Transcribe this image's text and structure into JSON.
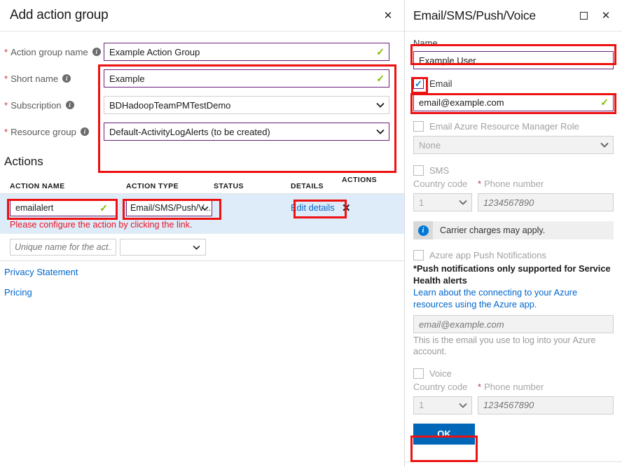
{
  "left_blade": {
    "title": "Add action group",
    "close_label": "✕",
    "fields": [
      {
        "label": "Action group name",
        "required": true,
        "value": "Example Action Group",
        "type": "text",
        "valid": true
      },
      {
        "label": "Short name",
        "required": true,
        "value": "Example",
        "type": "text",
        "valid": true
      },
      {
        "label": "Subscription",
        "required": true,
        "value": "BDHadoopTeamPMTestDemo",
        "type": "select",
        "valid": false
      },
      {
        "label": "Resource group",
        "required": true,
        "value": "Default-ActivityLogAlerts (to be created)",
        "type": "select",
        "valid": false
      }
    ],
    "actions_heading": "Actions",
    "table": {
      "headers": [
        "ACTION NAME",
        "ACTION TYPE",
        "STATUS",
        "DETAILS",
        "ACTIONS"
      ],
      "row": {
        "name_value": "emailalert",
        "type_value": "Email/SMS/Push/V...",
        "status_value": "",
        "details_link": "Edit details",
        "remove_label": "✕",
        "error_message": "Please configure the action by clicking the link."
      },
      "new_row": {
        "name_placeholder": "Unique name for the act...",
        "type_value": ""
      }
    },
    "footer_links": [
      "Privacy Statement",
      "Pricing"
    ]
  },
  "right_blade": {
    "title": "Email/SMS/Push/Voice",
    "maximize_label": "□",
    "close_label": "✕",
    "name_label": "Name",
    "name_value": "Example User",
    "email": {
      "checkbox_label": "Email",
      "checked": true,
      "value": "email@example.com",
      "valid": true
    },
    "arm_role": {
      "checkbox_label": "Email Azure Resource Manager Role",
      "checked": false,
      "select_value": "None"
    },
    "sms": {
      "checkbox_label": "SMS",
      "checked": false,
      "country_code_label": "Country code",
      "country_code_value": "1",
      "phone_label": "Phone number",
      "phone_placeholder": "1234567890"
    },
    "carrier_note": "Carrier charges may apply.",
    "push": {
      "checkbox_label": "Azure app Push Notifications",
      "checked": false,
      "bold_note": "*Push notifications only supported for Service Health alerts",
      "learn_link": "Learn about the connecting to your Azure resources using the Azure app.",
      "email_placeholder": "email@example.com",
      "help_text": "This is the email you use to log into your Azure account."
    },
    "voice": {
      "checkbox_label": "Voice",
      "checked": false,
      "country_code_label": "Country code",
      "country_code_value": "1",
      "phone_label": "Phone number",
      "phone_placeholder": "1234567890"
    },
    "ok_label": "OK"
  },
  "colors": {
    "accent_purple": "#68217a",
    "highlight_red": "#ee1111",
    "link_blue": "#0066cc",
    "valid_green": "#7fba00",
    "error_red": "#e81123",
    "row_highlight": "#deecf9",
    "primary_button": "#0067b8"
  }
}
